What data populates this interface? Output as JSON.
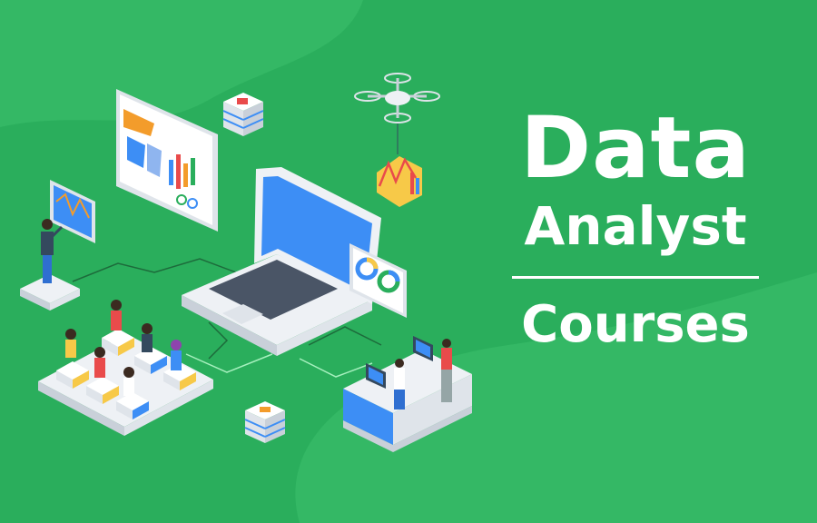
{
  "banner": {
    "title_line1": "Data",
    "title_line2": "Analyst",
    "title_line3": "Courses"
  },
  "colors": {
    "background": "#2aae5c",
    "background_blob": "#34b865",
    "text": "#ffffff",
    "screen_blue": "#3d8ef5",
    "platform_white": "#eef1f5",
    "accent_orange": "#f39c2b",
    "accent_red": "#e94b4b"
  },
  "icons": [
    "laptop-icon",
    "drone-icon",
    "dashboard-screen-icon",
    "database-stack-icon",
    "pie-chart-card-icon",
    "presenter-person-icon",
    "classroom-group-icon",
    "workstation-desk-icon"
  ]
}
